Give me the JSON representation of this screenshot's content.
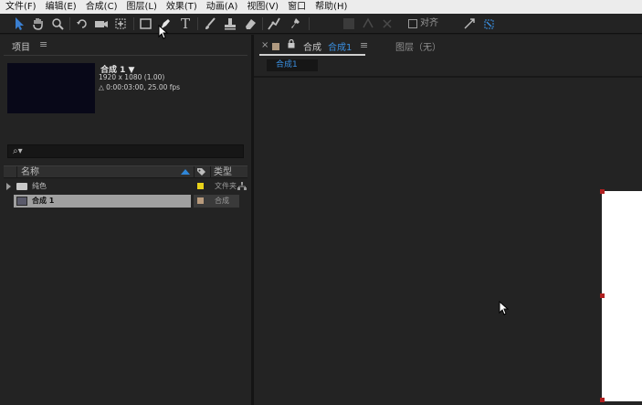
{
  "menubar": {
    "items": [
      "文件(F)",
      "编辑(E)",
      "合成(C)",
      "图层(L)",
      "效果(T)",
      "动画(A)",
      "视图(V)",
      "窗口",
      "帮助(H)"
    ]
  },
  "toolbar": {
    "tools": [
      "selection-tool",
      "hand-tool",
      "zoom-tool",
      "rotate-tool",
      "camera-tool",
      "pan-behind-tool",
      "rectangle-tool",
      "pen-tool",
      "type-tool",
      "brush-tool",
      "clone-stamp-tool",
      "eraser-tool",
      "roto-brush-tool",
      "puppet-pin-tool"
    ],
    "type_glyph": "T",
    "align_label": "对齐"
  },
  "project_panel": {
    "title": "项目",
    "menu_glyph": "≡",
    "preview": {
      "name": "合成 1 ▼",
      "resolution": "1920 x 1080 (1.00)",
      "duration": "△ 0:00:03:00, 25.00 fps"
    },
    "search_glyph": "⌕▾",
    "columns": {
      "name": "名称",
      "type": "类型"
    },
    "items": [
      {
        "name": "纯色",
        "type": "文件夹",
        "kind": "folder",
        "label_color": "#e8d21a"
      },
      {
        "name": "合成 1",
        "type": "合成",
        "kind": "composition",
        "label_color": "#b89a7c",
        "selected": true
      }
    ]
  },
  "comp_panel": {
    "tab_close": "×",
    "tab_lock": "🔒",
    "tab_label": "合成",
    "tab_name": "合成1",
    "tab_menu": "≡",
    "layer_tab": "图层（无）",
    "subtab": "合成1"
  },
  "colors": {
    "accent": "#3a8fe0",
    "panel_bg": "#232323",
    "menubar_bg": "#ececec",
    "handle": "#b02020"
  }
}
